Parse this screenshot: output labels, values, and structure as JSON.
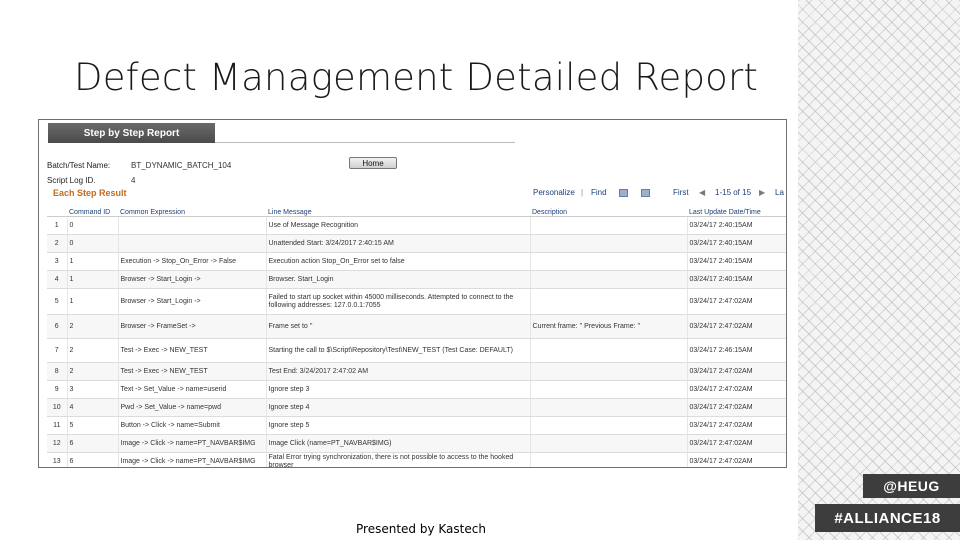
{
  "slide": {
    "title": "Defect Management Detailed Report",
    "footer": "Presented by Kastech",
    "tag_heug": "@HEUG",
    "tag_alliance": "#ALLIANCE18"
  },
  "report": {
    "tab_label": "Step by Step Report",
    "batch_label": "Batch/Test Name:",
    "batch_value": "BT_DYNAMIC_BATCH_104",
    "script_label": "Script Log ID.",
    "script_value": "4",
    "home_label": "Home",
    "section_title": "Each Step Result",
    "nav": {
      "personalize": "Personalize",
      "find": "Find",
      "first": "First",
      "range": "1-15 of 15",
      "last": "La"
    },
    "columns": [
      "",
      "Command ID",
      "Common Expression",
      "Line Message",
      "Description",
      "Last Update Date/Time"
    ],
    "rows": [
      {
        "step": "1",
        "cmd": "0",
        "expr": "",
        "msg": "Use of Message Recognition",
        "desc": "",
        "time": "03/24/17 2:40:15AM"
      },
      {
        "step": "2",
        "cmd": "0",
        "expr": "",
        "msg": "Unattended Start: 3/24/2017 2:40:15 AM",
        "desc": "",
        "time": "03/24/17 2:40:15AM"
      },
      {
        "step": "3",
        "cmd": "1",
        "expr": "Execution -> Stop_On_Error -> False",
        "msg": "Execution action Stop_On_Error set to false",
        "desc": "",
        "time": "03/24/17 2:40:15AM"
      },
      {
        "step": "4",
        "cmd": "1",
        "expr": "Browser -> Start_Login ->",
        "msg": "Browser. Start_Login",
        "desc": "",
        "time": "03/24/17 2:40:15AM"
      },
      {
        "step": "5",
        "cmd": "1",
        "expr": "Browser -> Start_Login ->",
        "msg": "Failed to start up socket within 45000 milliseconds. Attempted to connect to the following addresses: 127.0.0.1:7055",
        "desc": "",
        "time": "03/24/17 2:47:02AM"
      },
      {
        "step": "6",
        "cmd": "2",
        "expr": "Browser -> FrameSet ->",
        "msg": "Frame set to ''",
        "desc": "Current frame: '' Previous Frame: ''",
        "time": "03/24/17 2:47:02AM"
      },
      {
        "step": "7",
        "cmd": "2",
        "expr": "Test -> Exec -> NEW_TEST",
        "msg": "Starting the call to $\\Script\\Repository\\Test\\NEW_TEST (Test Case: DEFAULT)",
        "desc": "",
        "time": "03/24/17 2:46:15AM"
      },
      {
        "step": "8",
        "cmd": "2",
        "expr": "Test -> Exec -> NEW_TEST",
        "msg": "Test End: 3/24/2017 2:47:02 AM",
        "desc": "",
        "time": "03/24/17 2:47:02AM"
      },
      {
        "step": "9",
        "cmd": "3",
        "expr": "Text -> Set_Value -> name=userid",
        "msg": "Ignore step 3",
        "desc": "",
        "time": "03/24/17 2:47:02AM"
      },
      {
        "step": "10",
        "cmd": "4",
        "expr": "Pwd -> Set_Value -> name=pwd",
        "msg": "Ignore step 4",
        "desc": "",
        "time": "03/24/17 2:47:02AM"
      },
      {
        "step": "11",
        "cmd": "5",
        "expr": "Button -> Click -> name=Submit",
        "msg": "Ignore step 5",
        "desc": "",
        "time": "03/24/17 2:47:02AM"
      },
      {
        "step": "12",
        "cmd": "6",
        "expr": "Image -> Click -> name=PT_NAVBAR$IMG",
        "msg": "Image Click (name=PT_NAVBAR$IMG)",
        "desc": "",
        "time": "03/24/17 2:47:02AM"
      },
      {
        "step": "13",
        "cmd": "6",
        "expr": "Image -> Click -> name=PT_NAVBAR$IMG",
        "msg": "Fatal Error trying synchronization, there is not possible to access to the hooked browser",
        "desc": "",
        "time": "03/24/17 2:47:02AM"
      }
    ]
  }
}
